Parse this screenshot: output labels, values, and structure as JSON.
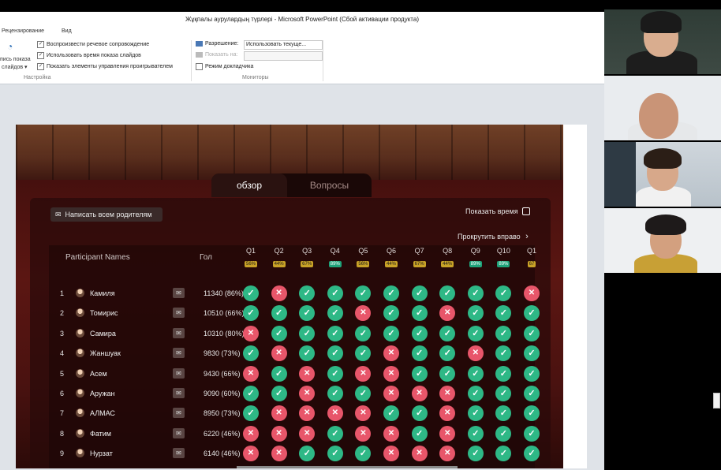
{
  "window": {
    "title": "Жұқпалы аурулардың түрлері  -  Microsoft PowerPoint (Сбой активации продукта)"
  },
  "tabs": [
    "Рецензирование",
    "Вид"
  ],
  "ribbon": {
    "setup": {
      "record_label_1": "пись показа",
      "record_label_2": "слайдов ▾",
      "options": [
        {
          "label": "Воспроизвести речевое сопровождение",
          "checked": true
        },
        {
          "label": "Использовать время показа слайдов",
          "checked": true
        },
        {
          "label": "Показать элементы управления проигрывателем",
          "checked": true
        }
      ],
      "group_label": "Настройка"
    },
    "monitors": {
      "resolution_label": "Разрешение:",
      "resolution_value": "Использовать текуще...",
      "show_on_label": "Показать на:",
      "show_on_value": "",
      "presenter_view": {
        "label": "Режим докладчика",
        "checked": false
      },
      "group_label": "Мониторы"
    }
  },
  "game": {
    "tabs": [
      "обзор",
      "Вопросы"
    ],
    "message_all": "Написать всем родителям",
    "show_time": "Показать время",
    "scroll_right": "Прокрутить вправо",
    "col_names": "Participant Names",
    "col_score": "Гол",
    "questions": [
      {
        "label": "Q1",
        "pct": "56%",
        "tone": "y"
      },
      {
        "label": "Q2",
        "pct": "44%",
        "tone": "y"
      },
      {
        "label": "Q3",
        "pct": "67%",
        "tone": "y"
      },
      {
        "label": "Q4",
        "pct": "89%",
        "tone": "g"
      },
      {
        "label": "Q5",
        "pct": "56%",
        "tone": "y"
      },
      {
        "label": "Q6",
        "pct": "44%",
        "tone": "y"
      },
      {
        "label": "Q7",
        "pct": "67%",
        "tone": "y"
      },
      {
        "label": "Q8",
        "pct": "44%",
        "tone": "y"
      },
      {
        "label": "Q9",
        "pct": "89%",
        "tone": "g"
      },
      {
        "label": "Q10",
        "pct": "89%",
        "tone": "g"
      },
      {
        "label": "Q1",
        "pct": "67",
        "tone": "y"
      }
    ],
    "rows": [
      {
        "num": "1",
        "name": "Камиля",
        "score": "11340 (86%)",
        "answers": [
          1,
          0,
          1,
          1,
          1,
          1,
          1,
          1,
          1,
          1,
          0
        ]
      },
      {
        "num": "2",
        "name": "Томирис",
        "score": "10510 (66%)",
        "answers": [
          1,
          1,
          1,
          1,
          0,
          1,
          1,
          0,
          1,
          1,
          1
        ]
      },
      {
        "num": "3",
        "name": "Самира",
        "score": "10310 (80%)",
        "answers": [
          0,
          1,
          1,
          1,
          1,
          1,
          1,
          1,
          1,
          1,
          1
        ]
      },
      {
        "num": "4",
        "name": "Жаншуак",
        "score": "9830 (73%)",
        "answers": [
          1,
          0,
          1,
          1,
          1,
          0,
          1,
          1,
          0,
          1,
          1
        ]
      },
      {
        "num": "5",
        "name": "Асем",
        "score": "9430 (66%)",
        "answers": [
          0,
          1,
          0,
          1,
          0,
          0,
          1,
          1,
          1,
          1,
          1
        ]
      },
      {
        "num": "6",
        "name": "Аружан",
        "score": "9090 (60%)",
        "answers": [
          1,
          1,
          0,
          1,
          1,
          0,
          0,
          0,
          1,
          1,
          1
        ]
      },
      {
        "num": "7",
        "name": "АЛМАС",
        "score": "8950 (73%)",
        "answers": [
          1,
          0,
          0,
          0,
          0,
          1,
          1,
          0,
          1,
          1,
          1
        ]
      },
      {
        "num": "8",
        "name": "Фатим",
        "score": "6220 (46%)",
        "answers": [
          0,
          0,
          0,
          1,
          0,
          0,
          1,
          0,
          1,
          1,
          1
        ]
      },
      {
        "num": "9",
        "name": "Нурзат",
        "score": "6140 (46%)",
        "answers": [
          0,
          0,
          1,
          1,
          1,
          0,
          0,
          0,
          1,
          1,
          1
        ]
      }
    ]
  }
}
